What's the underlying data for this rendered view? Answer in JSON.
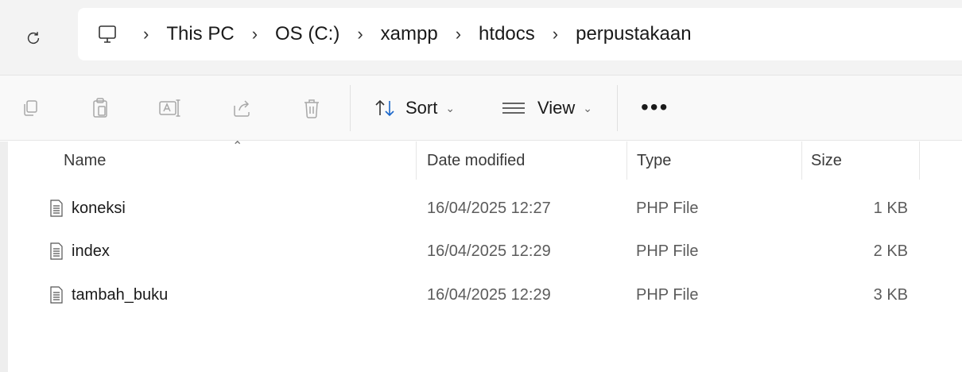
{
  "address_bar": {
    "refresh_icon": "refresh-icon",
    "pc_icon": "monitor-icon",
    "breadcrumbs": [
      "This PC",
      "OS (C:)",
      "xampp",
      "htdocs",
      "perpustakaan"
    ],
    "separator": "›"
  },
  "toolbar": {
    "icons": [
      "copy-icon",
      "paste-icon",
      "rename-icon",
      "share-icon",
      "delete-icon"
    ],
    "sort_label": "Sort",
    "view_label": "View",
    "more_label": "•••"
  },
  "columns": {
    "name": "Name",
    "date": "Date modified",
    "type": "Type",
    "size": "Size"
  },
  "files": [
    {
      "name": "koneksi",
      "date": "16/04/2025 12:27",
      "type": "PHP File",
      "size": "1 KB"
    },
    {
      "name": "index",
      "date": "16/04/2025 12:29",
      "type": "PHP File",
      "size": "2 KB"
    },
    {
      "name": "tambah_buku",
      "date": "16/04/2025 12:29",
      "type": "PHP File",
      "size": "3 KB"
    }
  ]
}
